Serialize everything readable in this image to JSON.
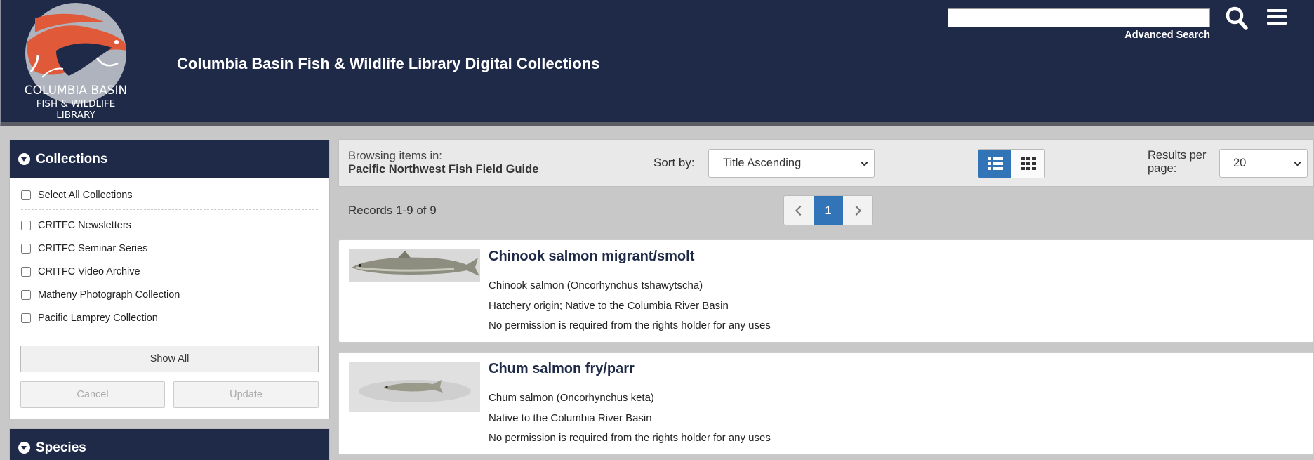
{
  "header": {
    "logo_line1": "COLUMBIA BASIN",
    "logo_line2": "FISH & WILDLIFE",
    "logo_line3": "LIBRARY",
    "site_title": "Columbia Basin Fish & Wildlife Library Digital Collections",
    "search_value": "",
    "advanced_search": "Advanced Search"
  },
  "collections_panel": {
    "title": "Collections",
    "select_all": "Select All Collections",
    "items": [
      {
        "label": "CRITFC Newsletters"
      },
      {
        "label": "CRITFC Seminar Series"
      },
      {
        "label": "CRITFC Video Archive"
      },
      {
        "label": "Matheny Photograph Collection"
      },
      {
        "label": "Pacific Lamprey Collection"
      }
    ],
    "show_all": "Show All",
    "cancel": "Cancel",
    "update": "Update"
  },
  "species_panel": {
    "title": "Species"
  },
  "toolbar": {
    "browsing_label": "Browsing items in:",
    "collection_name": "Pacific Northwest Fish Field Guide",
    "sort_label": "Sort by:",
    "sort_value": "Title Ascending",
    "results_label_1": "Results per",
    "results_label_2": "page:",
    "results_value": "20"
  },
  "records_text": "Records 1-9 of 9",
  "pager": {
    "current": "1"
  },
  "results": [
    {
      "title": "Chinook salmon migrant/smolt",
      "lines": [
        "Chinook salmon (Oncorhynchus tshawytscha)",
        "Hatchery origin; Native to the Columbia River Basin",
        "No permission is required from the rights holder for any uses"
      ]
    },
    {
      "title": "Chum salmon fry/parr",
      "lines": [
        "Chum salmon (Oncorhynchus keta)",
        "Native to the Columbia River Basin",
        "No permission is required from the rights holder for any uses"
      ]
    }
  ],
  "colors": {
    "header_bg": "#1f2a49",
    "accent_blue": "#3174b8",
    "logo_orange": "#e05a3a"
  }
}
